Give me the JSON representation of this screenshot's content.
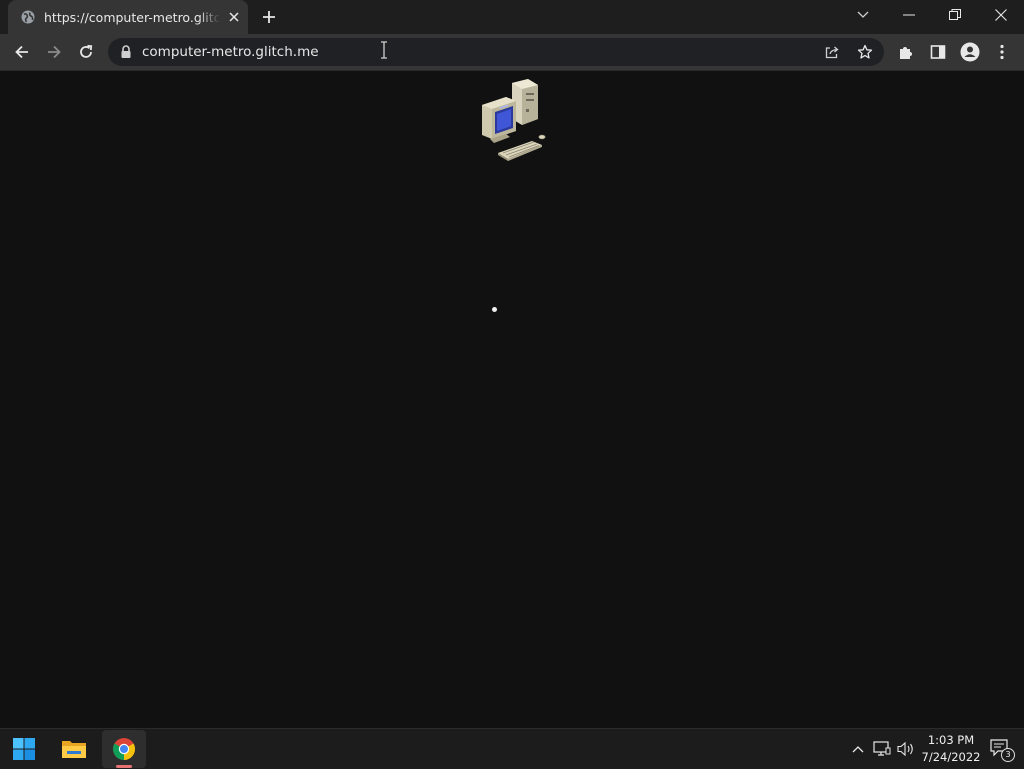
{
  "browser": {
    "tab": {
      "title": "https://computer-metro.glitch.me",
      "favicon": "globe-icon",
      "close_icon": "close-icon"
    },
    "new_tab_icon": "plus-icon",
    "window_controls": [
      "tab-search-icon",
      "minimize-icon",
      "restore-icon",
      "close-icon"
    ],
    "toolbar": {
      "back_icon": "back-arrow-icon",
      "forward_icon": "forward-arrow-icon",
      "reload_icon": "reload-icon",
      "address": "computer-metro.glitch.me",
      "right_icons": [
        "share-icon",
        "bookmark-star-icon",
        "extensions-icon",
        "side-panel-icon",
        "profile-icon",
        "menu-icon"
      ]
    }
  },
  "page": {
    "logo": "retro-computer-icon",
    "loading_indicator": "loading-dot"
  },
  "taskbar": {
    "apps": [
      "windows-start-icon",
      "file-explorer-icon",
      "chrome-icon"
    ],
    "active_app": "chrome-icon",
    "tray_icons": [
      "chevron-up-icon",
      "network-icon",
      "volume-icon"
    ],
    "time": "1:03 PM",
    "date": "7/24/2022",
    "notification_count": "3"
  },
  "colors": {
    "page_background": "#111111",
    "toolbar": "#353535",
    "tabstrip": "#1e1e1e",
    "taskbar": "#1c1c1c",
    "active_indicator": "#e57373"
  }
}
